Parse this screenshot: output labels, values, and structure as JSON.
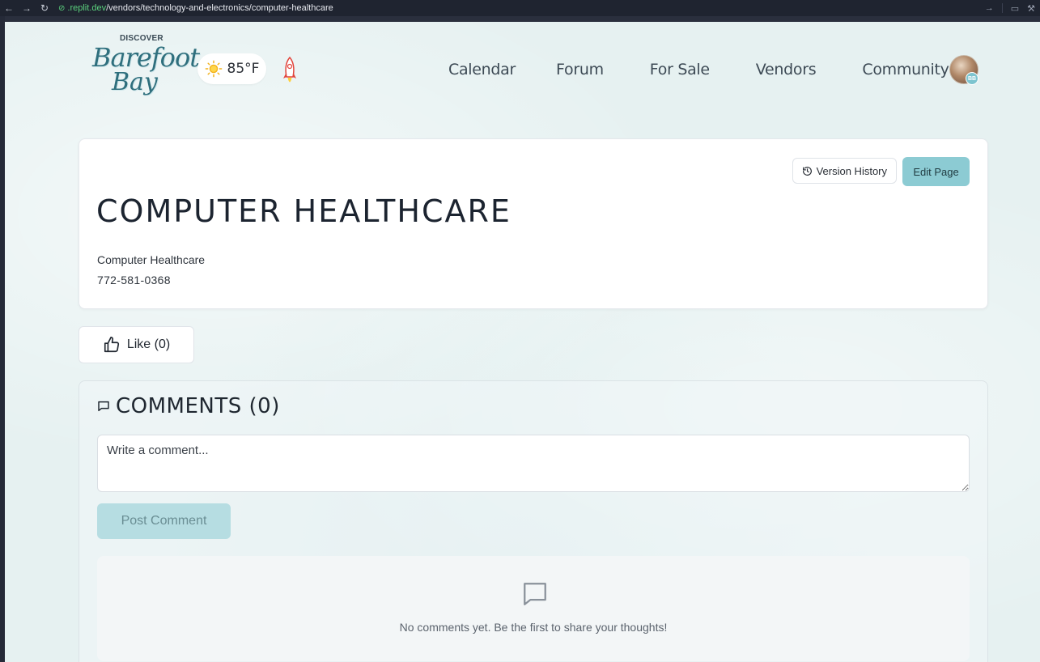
{
  "browser": {
    "url_domain": ".replit.dev",
    "url_path": "/vendors/technology-and-electronics/computer-healthcare"
  },
  "header": {
    "logo": {
      "discover": "DISCOVER",
      "line1": "Barefoot",
      "line2": "Bay"
    },
    "weather": {
      "temperature": "85°F",
      "icon": "sun-icon"
    },
    "nav": [
      "Calendar",
      "Forum",
      "For Sale",
      "Vendors",
      "Community"
    ],
    "avatar_badge": "BB"
  },
  "vendor": {
    "version_history_label": "Version History",
    "edit_label": "Edit Page",
    "title": "COMPUTER HEALTHCARE",
    "name": "Computer Healthcare",
    "phone": "772-581-0368"
  },
  "like": {
    "label": "Like (0)"
  },
  "comments": {
    "title": "COMMENTS (0)",
    "placeholder": "Write a comment...",
    "post_label": "Post Comment",
    "empty_text": "No comments yet. Be the first to share your thoughts!"
  },
  "colors": {
    "accent": "#8ccbd3",
    "post_disabled": "#b6dde2",
    "text": "#1c2430"
  }
}
